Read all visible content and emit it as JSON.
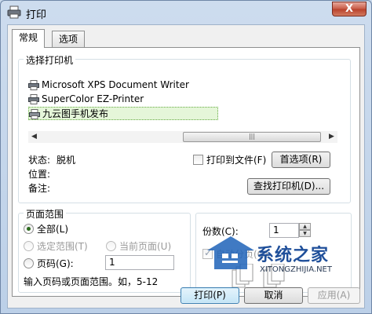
{
  "window": {
    "title": "打印",
    "close_glyph": "X"
  },
  "tabs": [
    {
      "label": "常规"
    },
    {
      "label": "选项"
    }
  ],
  "select_printer": {
    "label": "选择打印机",
    "printers": [
      {
        "name": "Microsoft XPS Document Writer"
      },
      {
        "name": "SuperColor EZ-Printer"
      },
      {
        "name": "九云图手机发布"
      }
    ]
  },
  "printer_info": {
    "status_label": "状态:",
    "status_value": "脱机",
    "location_label": "位置:",
    "location_value": "",
    "comment_label": "备注:",
    "comment_value": ""
  },
  "print_to_file": {
    "label": "打印到文件(F)",
    "checked": false
  },
  "buttons": {
    "preferences": "首选项(R)",
    "find_printer": "查找打印机(D)...",
    "print": "打印(P)",
    "cancel": "取消",
    "apply": "应用(A)"
  },
  "page_range": {
    "label": "页面范围",
    "all": "全部(L)",
    "selection": "选定范围(T)",
    "current_page": "当前页面(U)",
    "pages": "页码(G):",
    "pages_value": "1",
    "hint": "输入页码或页面范围。如，5-12"
  },
  "copies": {
    "label": "份数(C):",
    "value": "1",
    "collate": "自动分页(O)"
  },
  "watermark": {
    "logo_text": "系统之家",
    "url": "XITONGZHIJIA.NET"
  }
}
